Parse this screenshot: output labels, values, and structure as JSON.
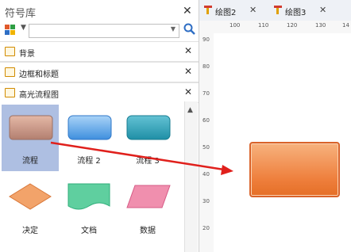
{
  "library": {
    "title": "符号库",
    "close": "✕",
    "search": {
      "value": "",
      "placeholder": ""
    },
    "categories": [
      {
        "label": "背景",
        "close": "✕"
      },
      {
        "label": "边框和标题",
        "close": "✕"
      },
      {
        "label": "高光流程图",
        "close": "✕"
      }
    ],
    "shapes": [
      {
        "label": "流程",
        "selected": true
      },
      {
        "label": "流程 2"
      },
      {
        "label": "流程 3"
      },
      {
        "label": "决定"
      },
      {
        "label": "文档"
      },
      {
        "label": "数据"
      }
    ]
  },
  "tabs": [
    {
      "label": "绘图2",
      "close": "✕"
    },
    {
      "label": "绘图3",
      "close": "✕"
    }
  ],
  "ruler": {
    "horizontal": [
      "100",
      "110",
      "120",
      "130",
      "14"
    ],
    "vertical": [
      "90",
      "80",
      "70",
      "60",
      "50",
      "40",
      "30",
      "20"
    ]
  },
  "colors": {
    "accent_blue": "#2f6ec4",
    "arrow_red": "#e0201c",
    "shape_orange": "#ee7e3b",
    "selection": "#aebfe2"
  }
}
